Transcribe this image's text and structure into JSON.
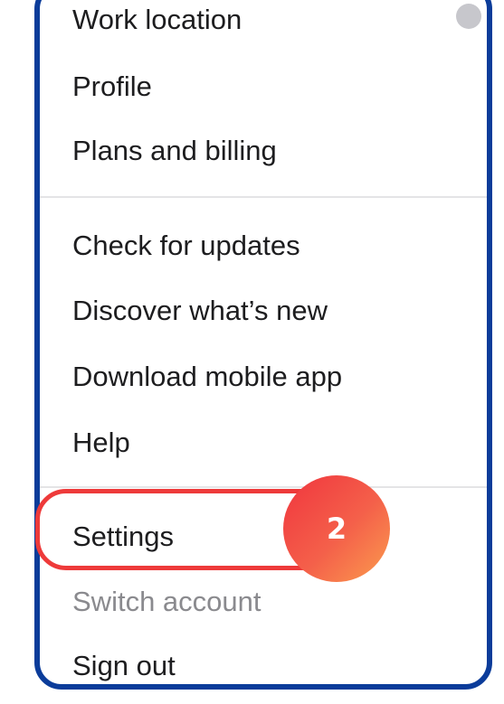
{
  "menu": {
    "partial_item_label": "Work location",
    "items": [
      {
        "label": "Profile"
      },
      {
        "label": "Plans and billing"
      },
      {
        "label": "Check for updates"
      },
      {
        "label": "Discover what’s new"
      },
      {
        "label": "Download mobile app"
      },
      {
        "label": "Help"
      },
      {
        "label": "Settings"
      },
      {
        "label": "Switch account"
      },
      {
        "label": "Sign out"
      }
    ]
  },
  "annotation": {
    "step_number": "2",
    "highlighted_item": "Settings",
    "highlight_color": "#ee3a3a",
    "badge_colors": [
      "#f0353e",
      "#fb9c4e"
    ]
  },
  "colors": {
    "frame_border": "#0b3c9a",
    "text": "#1d1d1f",
    "muted_text": "#8a8a8e",
    "divider": "#e4e4e6"
  }
}
